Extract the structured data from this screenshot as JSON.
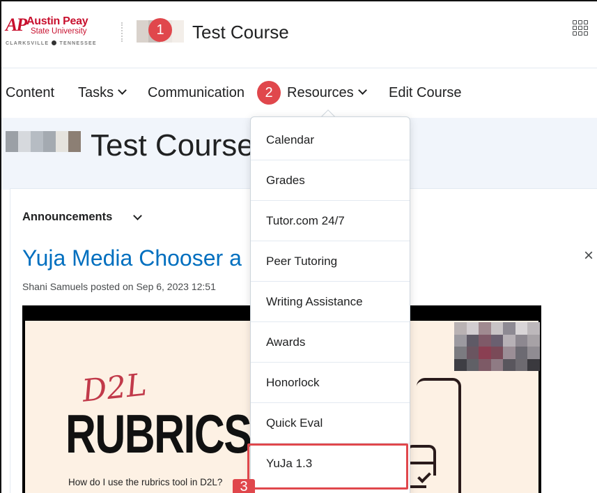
{
  "logo": {
    "mark": "AP",
    "name": "Austin Peay",
    "sub": "State University",
    "city_left": "CLARKSVILLE",
    "city_right": "TENNESSEE"
  },
  "header": {
    "course_title": "Test Course",
    "apps_icon": "waffle-grid-icon"
  },
  "nav": {
    "items": [
      {
        "label": "Content"
      },
      {
        "label": "Tasks"
      },
      {
        "label": "Communication"
      },
      {
        "label": "Resources"
      },
      {
        "label": "Edit Course"
      }
    ]
  },
  "banner": {
    "title": "Test Course"
  },
  "announcements": {
    "heading": "Announcements",
    "post_title": "Yuja Media Chooser a",
    "post_meta": "Shani Samuels posted on Sep 6, 2023 12:51",
    "close_icon": "×"
  },
  "video": {
    "script_text": "D2L",
    "headline": "RUBRICS",
    "caption": "How do I use the rubrics tool in D2L?"
  },
  "resources_menu": {
    "items": [
      {
        "label": "Calendar"
      },
      {
        "label": "Grades"
      },
      {
        "label": "Tutor.com 24/7"
      },
      {
        "label": "Peer Tutoring"
      },
      {
        "label": "Writing Assistance"
      },
      {
        "label": "Awards"
      },
      {
        "label": "Honorlock"
      },
      {
        "label": "Quick Eval"
      },
      {
        "label": "YuJa 1.3"
      }
    ]
  },
  "steps": [
    "1",
    "2",
    "3"
  ],
  "colors": {
    "brand_red": "#c8102e",
    "badge_red": "#e0474c",
    "link_blue": "#006fbf",
    "banner_bg": "#f1f5fb"
  }
}
